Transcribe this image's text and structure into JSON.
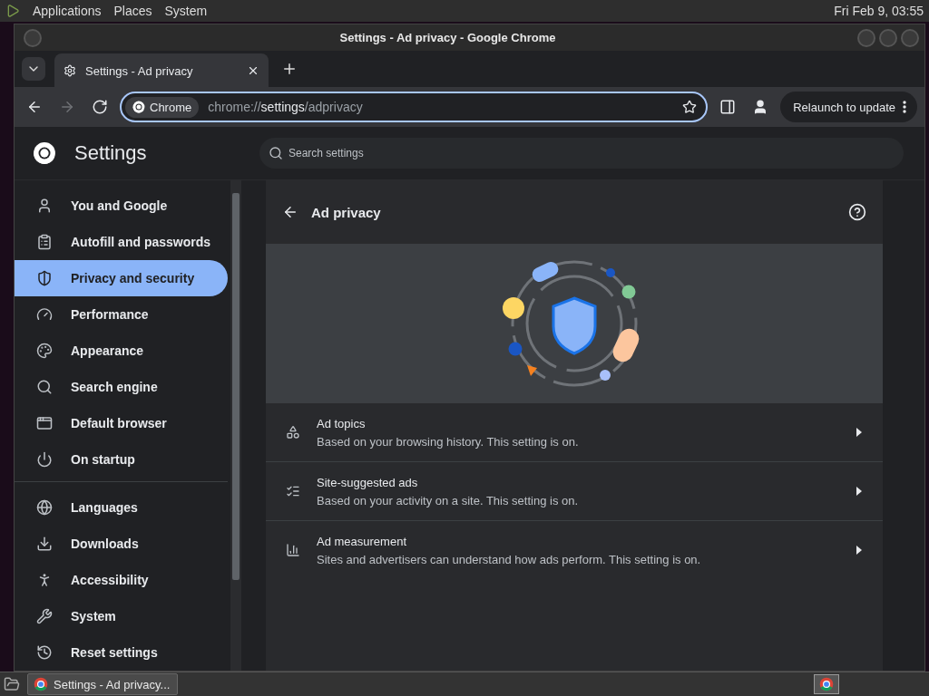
{
  "top_panel": {
    "menus": [
      "Applications",
      "Places",
      "System"
    ],
    "clock": "Fri Feb 9, 03:55"
  },
  "window": {
    "title": "Settings - Ad privacy - Google Chrome"
  },
  "tabs": [
    {
      "title": "Settings - Ad privacy",
      "selected": true
    }
  ],
  "nav_buttons": [
    {
      "kind": "back",
      "disabled": false
    },
    {
      "kind": "forward",
      "disabled": true
    },
    {
      "kind": "reload",
      "disabled": false
    }
  ],
  "omnibox": {
    "chip": "Chrome",
    "url_scheme": "chrome://",
    "url_host": "settings",
    "url_path": "/adprivacy",
    "bookmarked": false
  },
  "relaunch_button": "Relaunch to update",
  "settings": {
    "title": "Settings",
    "search": {
      "placeholder": "Search settings"
    }
  },
  "sidebar": {
    "groups": [
      [
        {
          "label": "You and Google",
          "selected": false
        },
        {
          "label": "Autofill and passwords",
          "selected": false
        },
        {
          "label": "Privacy and security",
          "selected": true
        },
        {
          "label": "Performance",
          "selected": false
        },
        {
          "label": "Appearance",
          "selected": false
        },
        {
          "label": "Search engine",
          "selected": false
        },
        {
          "label": "Default browser",
          "selected": false
        },
        {
          "label": "On startup",
          "selected": false
        }
      ],
      [
        {
          "label": "Languages",
          "selected": false
        },
        {
          "label": "Downloads",
          "selected": false
        },
        {
          "label": "Accessibility",
          "selected": false
        },
        {
          "label": "System",
          "selected": false
        },
        {
          "label": "Reset settings",
          "selected": false
        }
      ]
    ]
  },
  "page": {
    "title": "Ad privacy",
    "rows": [
      {
        "title": "Ad topics",
        "description": "Based on your browsing history. This setting is on."
      },
      {
        "title": "Site-suggested ads",
        "description": "Based on your activity on a site. This setting is on."
      },
      {
        "title": "Ad measurement",
        "description": "Sites and advertisers can understand how ads perform. This setting is on."
      }
    ]
  },
  "taskbar": {
    "tasks": [
      {
        "label": "Settings - Ad privacy..."
      }
    ]
  }
}
